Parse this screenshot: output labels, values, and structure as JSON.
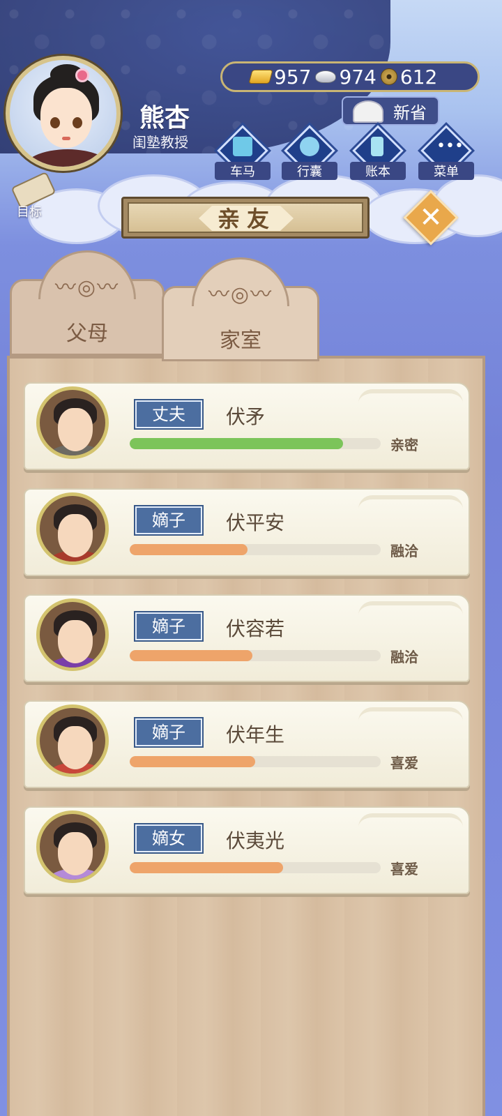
{
  "player": {
    "name": "熊杏",
    "title": "闺塾教授"
  },
  "currency": {
    "gold": "957",
    "silver": "974",
    "copper": "612"
  },
  "save_label": "新省",
  "menu": [
    {
      "label": "车马",
      "icon": "carriage-icon"
    },
    {
      "label": "行囊",
      "icon": "bag-icon"
    },
    {
      "label": "账本",
      "icon": "ledger-icon"
    },
    {
      "label": "菜单",
      "icon": "more-icon"
    }
  ],
  "goal_label": "目标",
  "panel_title": "亲友",
  "tabs": [
    {
      "label": "父母",
      "active": false
    },
    {
      "label": "家室",
      "active": true
    }
  ],
  "members": [
    {
      "role": "丈夫",
      "name": "伏矛",
      "relation": "亲密",
      "affinity": 0.85,
      "bar_color": "#7cc45a"
    },
    {
      "role": "嫡子",
      "name": "伏平安",
      "relation": "融洽",
      "affinity": 0.47,
      "bar_color": "#eea46a"
    },
    {
      "role": "嫡子",
      "name": "伏容若",
      "relation": "融洽",
      "affinity": 0.49,
      "bar_color": "#eea46a"
    },
    {
      "role": "嫡子",
      "name": "伏年生",
      "relation": "喜爱",
      "affinity": 0.5,
      "bar_color": "#eea46a"
    },
    {
      "role": "嫡女",
      "name": "伏夷光",
      "relation": "喜爱",
      "affinity": 0.61,
      "bar_color": "#eea46a"
    }
  ]
}
